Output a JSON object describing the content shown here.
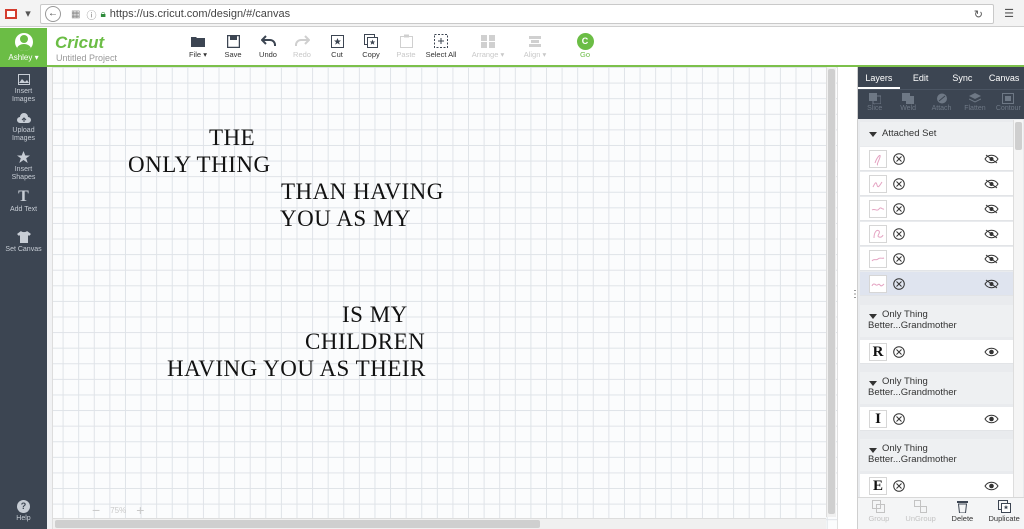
{
  "browser": {
    "url": "https://us.cricut.com/design/#/canvas"
  },
  "header": {
    "user_label": "Ashley",
    "logo": "Cricut",
    "project_name": "Untitled Project",
    "tools": [
      {
        "label": "File",
        "icon": "folder-icon",
        "enabled": true
      },
      {
        "label": "Save",
        "icon": "save-icon",
        "enabled": true
      },
      {
        "label": "Undo",
        "icon": "undo-icon",
        "enabled": true
      },
      {
        "label": "Redo",
        "icon": "redo-icon",
        "enabled": false
      },
      {
        "label": "Cut",
        "icon": "cut-icon",
        "enabled": true
      },
      {
        "label": "Copy",
        "icon": "copy-icon",
        "enabled": true
      },
      {
        "label": "Paste",
        "icon": "paste-icon",
        "enabled": false
      },
      {
        "label": "Select All",
        "icon": "select-all-icon",
        "enabled": true
      },
      {
        "label": "Arrange",
        "icon": "arrange-icon",
        "enabled": false
      },
      {
        "label": "Align",
        "icon": "align-icon",
        "enabled": false
      },
      {
        "label": "Go",
        "icon": "go-icon",
        "enabled": true
      }
    ]
  },
  "sidebar": {
    "items": [
      {
        "label_line1": "Insert",
        "label_line2": "Images",
        "icon": "image-icon"
      },
      {
        "label_line1": "Upload",
        "label_line2": "Images",
        "icon": "upload-icon"
      },
      {
        "label_line1": "Insert",
        "label_line2": "Shapes",
        "icon": "shapes-icon"
      },
      {
        "label_line1": "Add Text",
        "label_line2": "",
        "icon": "text-icon"
      },
      {
        "label_line1": "Set Canvas",
        "label_line2": "",
        "icon": "shirt-icon"
      }
    ],
    "help_label": "Help"
  },
  "canvas": {
    "lines": [
      "THE",
      "ONLY THING",
      "THAN HAVING",
      "YOU AS MY",
      "IS MY",
      "CHILDREN",
      "HAVING YOU AS THEIR"
    ],
    "zoom_label": "75%"
  },
  "panel": {
    "tabs": [
      "Layers",
      "Edit",
      "Sync",
      "Canvas"
    ],
    "active_tab": "Layers",
    "actions": [
      "Slice",
      "Weld",
      "Attach",
      "Flatten",
      "Contour"
    ],
    "groups": [
      {
        "title": "Attached Set",
        "title_line2": ""
      },
      {
        "title": "Only Thing",
        "title_line2": "Better...Grandmother"
      },
      {
        "title": "Only Thing",
        "title_line2": "Better...Grandmother"
      },
      {
        "title": "Only Thing",
        "title_line2": "Better...Grandmother"
      }
    ],
    "group_letters": [
      "R",
      "I",
      "E"
    ],
    "footer": [
      {
        "label": "Group",
        "enabled": false
      },
      {
        "label": "UnGroup",
        "enabled": false
      },
      {
        "label": "Delete",
        "enabled": true
      },
      {
        "label": "Duplicate",
        "enabled": true
      }
    ]
  }
}
